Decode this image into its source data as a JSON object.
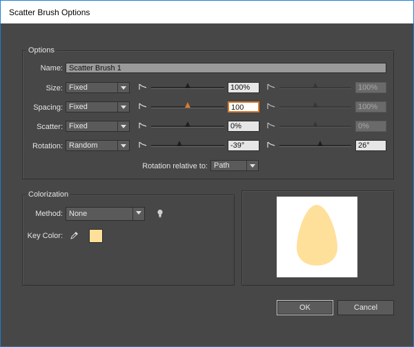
{
  "window": {
    "title": "Scatter Brush Options"
  },
  "options": {
    "legend": "Options",
    "name_label": "Name:",
    "name_value": "Scatter Brush 1",
    "rows": [
      {
        "label": "Size:",
        "mode": "Fixed",
        "min_value": "100%",
        "max_value": "100%",
        "min_level": 0.5,
        "max_level": 0.5,
        "max_disabled": true
      },
      {
        "label": "Spacing:",
        "mode": "Fixed",
        "min_value": "100",
        "max_value": "100%",
        "min_level": 0.5,
        "max_level": 0.5,
        "max_disabled": true
      },
      {
        "label": "Scatter:",
        "mode": "Fixed",
        "min_value": "0%",
        "max_value": "0%",
        "min_level": 0.5,
        "max_level": 0.5,
        "max_disabled": true
      },
      {
        "label": "Rotation:",
        "mode": "Random",
        "min_value": "-39°",
        "max_value": "26°",
        "min_level": 0.39,
        "max_level": 0.57,
        "max_disabled": false
      }
    ],
    "rotation_relative_label": "Rotation relative to:",
    "rotation_relative_value": "Path"
  },
  "colorization": {
    "legend": "Colorization",
    "method_label": "Method:",
    "method_value": "None",
    "key_color_label": "Key Color:",
    "key_color": "#ffe09a",
    "tip_icon": "lightbulb-icon",
    "eyedropper_icon": "eyedropper-icon"
  },
  "preview": {
    "shape_color": "#ffe09a"
  },
  "buttons": {
    "ok": "OK",
    "cancel": "Cancel"
  },
  "colors": {
    "accent": "#d87a2c",
    "dialog_bg": "#474747",
    "title_border": "#1a7fd1"
  }
}
